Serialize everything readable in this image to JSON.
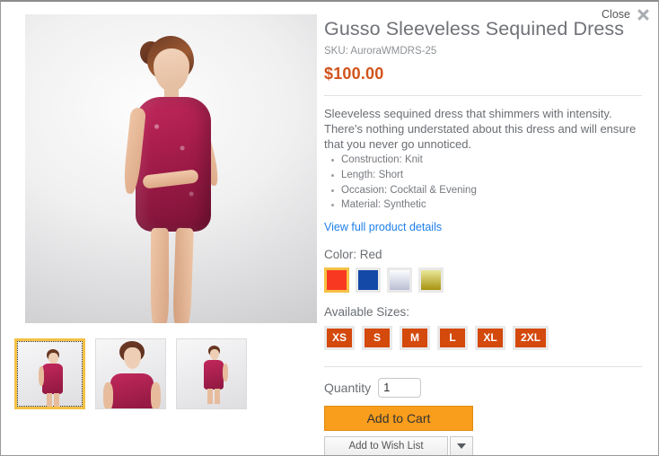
{
  "modal": {
    "close_label": "Close",
    "close_icon": "close-x-icon"
  },
  "product": {
    "title": "Gusso Sleeveless Sequined Dress",
    "sku": "SKU: AuroraWMDRS-25",
    "price": "$100.00",
    "description": "Sleeveless sequined dress that shimmers with intensity. There's nothing understated about this dress and will ensure that you never go unnoticed.",
    "attributes": [
      "Construction: Knit",
      "Length: Short",
      "Occasion: Cocktail & Evening",
      "Material: Synthetic"
    ],
    "details_link": "View full product details"
  },
  "color": {
    "label": "Color: Red",
    "options": [
      {
        "name": "Red",
        "hex": "#f93822",
        "selected": true
      },
      {
        "name": "Blue",
        "hex": "#1549a8",
        "selected": false
      },
      {
        "name": "White",
        "hex": "#e9ecf5",
        "selected": false
      },
      {
        "name": "Gold",
        "hex": "#b9a21a",
        "selected": false
      }
    ],
    "selected_border": "#f5c145"
  },
  "sizes": {
    "label": "Available Sizes:",
    "options": [
      "XS",
      "S",
      "M",
      "L",
      "XL",
      "2XL"
    ],
    "button_color": "#d4490c"
  },
  "purchase": {
    "quantity_label": "Quantity",
    "quantity_value": "1",
    "add_to_cart_label": "Add to Cart",
    "add_to_cart_color": "#f99d1c",
    "wish_list_label": "Add to Wish List",
    "wish_list_caret_icon": "caret-down-icon"
  },
  "gallery": {
    "thumbnails": [
      {
        "name": "full-body-front",
        "selected": true
      },
      {
        "name": "close-up-bodice",
        "selected": false
      },
      {
        "name": "side-pose",
        "selected": false
      }
    ],
    "main_image_alt": "model-wearing-red-sequined-dress"
  }
}
